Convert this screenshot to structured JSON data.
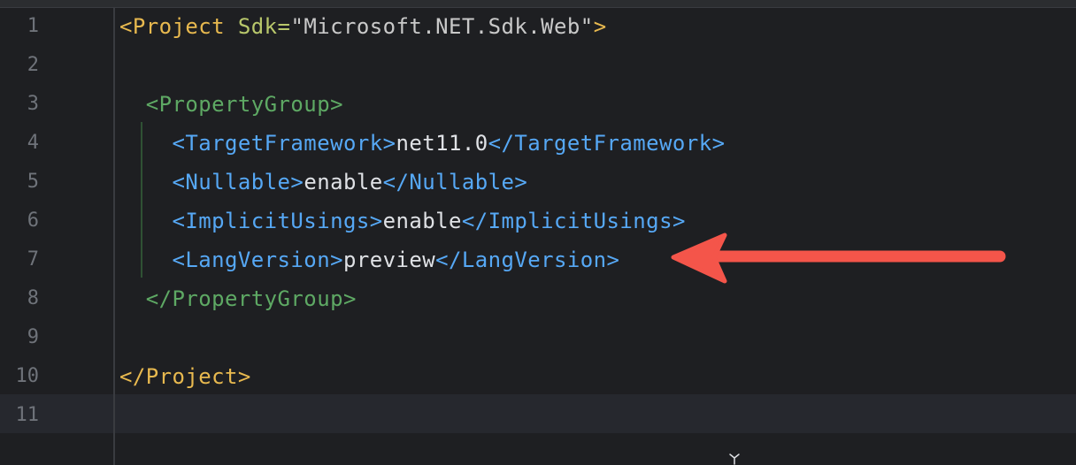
{
  "editor": {
    "caret_line": 11,
    "lines": [
      {
        "num": "1",
        "tokens": [
          [
            "c-tag-proj",
            "<Project "
          ],
          [
            "c-attr",
            "Sdk="
          ],
          [
            "c-str",
            "\"Microsoft.NET.Sdk.Web\""
          ],
          [
            "c-tag-proj",
            ">"
          ]
        ]
      },
      {
        "num": "2",
        "tokens": []
      },
      {
        "num": "3",
        "tokens": [
          [
            "c-tag-pg",
            "  <PropertyGroup>"
          ]
        ]
      },
      {
        "num": "4",
        "tokens": [
          [
            "c-tag-blue",
            "    <TargetFramework>"
          ],
          [
            "c-text",
            "net11.0"
          ],
          [
            "c-tag-blue",
            "</TargetFramework>"
          ]
        ]
      },
      {
        "num": "5",
        "tokens": [
          [
            "c-tag-blue",
            "    <Nullable>"
          ],
          [
            "c-text",
            "enable"
          ],
          [
            "c-tag-blue",
            "</Nullable>"
          ]
        ]
      },
      {
        "num": "6",
        "tokens": [
          [
            "c-tag-blue",
            "    <ImplicitUsings>"
          ],
          [
            "c-text",
            "enable"
          ],
          [
            "c-tag-blue",
            "</ImplicitUsings>"
          ]
        ]
      },
      {
        "num": "7",
        "tokens": [
          [
            "c-tag-blue",
            "    <LangVersion>"
          ],
          [
            "c-text",
            "preview"
          ],
          [
            "c-tag-blue",
            "</LangVersion>"
          ]
        ]
      },
      {
        "num": "8",
        "tokens": [
          [
            "c-tag-pg",
            "  </PropertyGroup>"
          ]
        ]
      },
      {
        "num": "9",
        "tokens": []
      },
      {
        "num": "10",
        "tokens": [
          [
            "c-tag-proj",
            "</Project>"
          ]
        ]
      },
      {
        "num": "11",
        "tokens": []
      }
    ]
  },
  "annotation": {
    "arrow_color": "#f4554a",
    "points_to_line": 7
  },
  "icons": {
    "corner": "tree-icon"
  },
  "colors": {
    "background": "#1e1f22",
    "tag_project": "#e8b94f",
    "tag_property_group": "#5ea964",
    "tag_property": "#56a8f5",
    "text": "#dfe1e5",
    "line_number": "#6f737a"
  }
}
